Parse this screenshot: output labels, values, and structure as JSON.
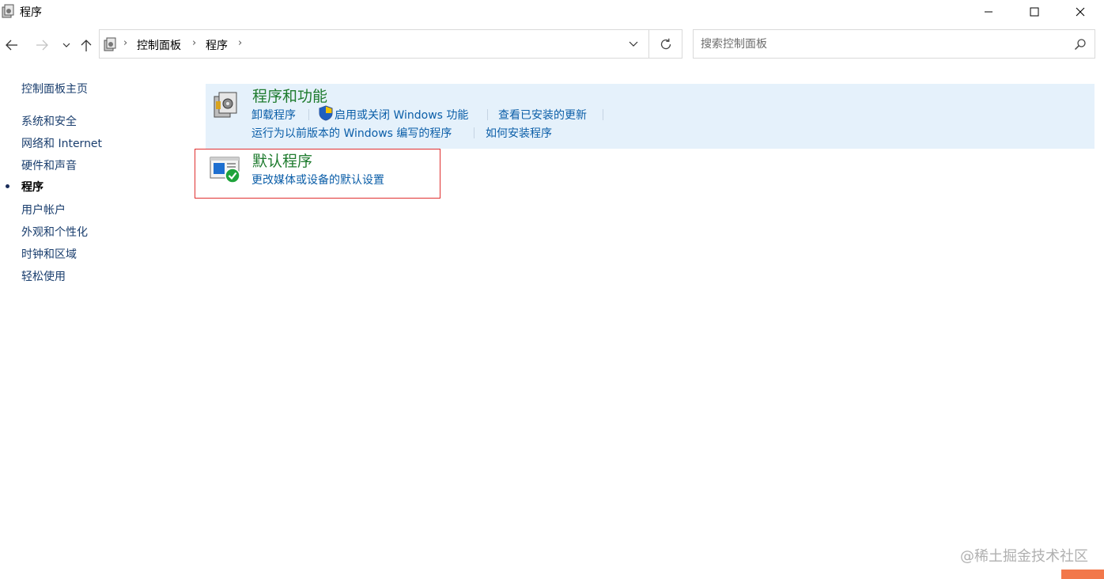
{
  "window": {
    "title": "程序"
  },
  "address": {
    "crumbs": [
      "控制面板",
      "程序"
    ]
  },
  "search": {
    "placeholder": "搜索控制面板"
  },
  "sidebar": {
    "home": "控制面板主页",
    "items": [
      {
        "label": "系统和安全"
      },
      {
        "label": "网络和 Internet"
      },
      {
        "label": "硬件和声音"
      },
      {
        "label": "程序",
        "active": true
      },
      {
        "label": "用户帐户"
      },
      {
        "label": "外观和个性化"
      },
      {
        "label": "时钟和区域"
      },
      {
        "label": "轻松使用"
      }
    ]
  },
  "groups": [
    {
      "title": "程序和功能",
      "links": [
        "卸载程序",
        "启用或关闭 Windows 功能",
        "查看已安装的更新",
        "运行为以前版本的 Windows 编写的程序",
        "如何安装程序"
      ]
    },
    {
      "title": "默认程序",
      "links": [
        "更改媒体或设备的默认设置"
      ]
    }
  ],
  "watermark": "@稀土掘金技术社区",
  "colors": {
    "group_title": "#1e7b2e",
    "link": "#0b5ea8",
    "highlight_bg": "#e5f1fb",
    "selection_outline": "#e03030"
  }
}
